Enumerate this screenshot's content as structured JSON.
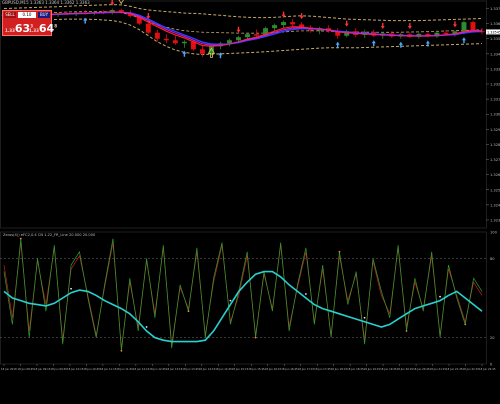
{
  "header": {
    "symbol_line": "GBPUSD,M15  1.3363 1.3364 1.3362 1.3363",
    "indicator_line": "Zeros(4)) eFC2,0.4 CN  1.22_FR_Line 20.000  20.000"
  },
  "trade_panel": {
    "sell_label": "SELL",
    "buy_label": "BUY",
    "lot_value": "0.10",
    "bid_prefix": "1.33",
    "bid_big": "63",
    "bid_sup": "3",
    "ask_prefix": "1.33",
    "ask_big": "64",
    "ask_sup": "8"
  },
  "colors": {
    "background": "#000000",
    "bull_candle": "#2e8b2e",
    "bear_candle": "#e01010",
    "ma_fast": "#ff2020",
    "ma_slow": "#3040ff",
    "ma_mid": "#cc22cc",
    "envelope": "#c9a86a",
    "osc_cyan": "#28d0d0",
    "osc_green": "#2e9e2e",
    "osc_red": "#c02020",
    "up_arrow": "#48a8ff",
    "down_arrow": "#ff3030",
    "grid": "#5a5a5a"
  },
  "chart_data": [
    {
      "type": "candlestick",
      "title": "",
      "y_ticks": [
        "1.33700",
        "1.33600",
        "1.33500",
        "1.33400",
        "1.33300",
        "1.33200",
        "1.33100",
        "1.33000",
        "1.32900",
        "1.32800",
        "1.32700",
        "1.32600",
        "1.32500",
        "1.32400",
        "1.32300"
      ],
      "ylim": [
        1.3226,
        1.3373
      ],
      "candles": [
        {
          "o": 1.33654,
          "h": 1.33672,
          "l": 1.33638,
          "c": 1.3366
        },
        {
          "o": 1.3366,
          "h": 1.3367,
          "l": 1.3364,
          "c": 1.33648
        },
        {
          "o": 1.33648,
          "h": 1.33668,
          "l": 1.3364,
          "c": 1.33662
        },
        {
          "o": 1.33662,
          "h": 1.33675,
          "l": 1.3365,
          "c": 1.33655
        },
        {
          "o": 1.33655,
          "h": 1.3367,
          "l": 1.33645,
          "c": 1.33664
        },
        {
          "o": 1.33664,
          "h": 1.33678,
          "l": 1.33652,
          "c": 1.33658
        },
        {
          "o": 1.33658,
          "h": 1.33672,
          "l": 1.33646,
          "c": 1.33668
        },
        {
          "o": 1.33668,
          "h": 1.3368,
          "l": 1.33655,
          "c": 1.33662
        },
        {
          "o": 1.33662,
          "h": 1.33676,
          "l": 1.3365,
          "c": 1.33672
        },
        {
          "o": 1.33672,
          "h": 1.3369,
          "l": 1.3366,
          "c": 1.33668
        },
        {
          "o": 1.33668,
          "h": 1.33682,
          "l": 1.33655,
          "c": 1.33676
        },
        {
          "o": 1.33676,
          "h": 1.3369,
          "l": 1.33662,
          "c": 1.3367
        },
        {
          "o": 1.3367,
          "h": 1.337,
          "l": 1.3366,
          "c": 1.3369
        },
        {
          "o": 1.3369,
          "h": 1.337,
          "l": 1.33668,
          "c": 1.33674
        },
        {
          "o": 1.33674,
          "h": 1.3369,
          "l": 1.3364,
          "c": 1.3365
        },
        {
          "o": 1.3365,
          "h": 1.3366,
          "l": 1.3359,
          "c": 1.336
        },
        {
          "o": 1.336,
          "h": 1.3361,
          "l": 1.3353,
          "c": 1.3354
        },
        {
          "o": 1.3354,
          "h": 1.3356,
          "l": 1.3348,
          "c": 1.335
        },
        {
          "o": 1.335,
          "h": 1.3353,
          "l": 1.3347,
          "c": 1.3349
        },
        {
          "o": 1.3349,
          "h": 1.3352,
          "l": 1.3346,
          "c": 1.3347
        },
        {
          "o": 1.3347,
          "h": 1.3349,
          "l": 1.3344,
          "c": 1.3348
        },
        {
          "o": 1.3348,
          "h": 1.3349,
          "l": 1.3342,
          "c": 1.3343
        },
        {
          "o": 1.3343,
          "h": 1.3345,
          "l": 1.3338,
          "c": 1.334
        },
        {
          "o": 1.334,
          "h": 1.3346,
          "l": 1.3339,
          "c": 1.3345
        },
        {
          "o": 1.3345,
          "h": 1.3348,
          "l": 1.3343,
          "c": 1.3347
        },
        {
          "o": 1.3347,
          "h": 1.335,
          "l": 1.3345,
          "c": 1.3349
        },
        {
          "o": 1.3349,
          "h": 1.3352,
          "l": 1.3347,
          "c": 1.3351
        },
        {
          "o": 1.3351,
          "h": 1.3354,
          "l": 1.3349,
          "c": 1.3353
        },
        {
          "o": 1.3353,
          "h": 1.3356,
          "l": 1.335,
          "c": 1.3352
        },
        {
          "o": 1.3352,
          "h": 1.3358,
          "l": 1.3351,
          "c": 1.3357
        },
        {
          "o": 1.3357,
          "h": 1.336,
          "l": 1.3355,
          "c": 1.3359
        },
        {
          "o": 1.3359,
          "h": 1.3362,
          "l": 1.3357,
          "c": 1.3361
        },
        {
          "o": 1.3361,
          "h": 1.3363,
          "l": 1.3358,
          "c": 1.33595
        },
        {
          "o": 1.33595,
          "h": 1.3361,
          "l": 1.3356,
          "c": 1.33575
        },
        {
          "o": 1.33575,
          "h": 1.3359,
          "l": 1.3354,
          "c": 1.33555
        },
        {
          "o": 1.33555,
          "h": 1.3358,
          "l": 1.3353,
          "c": 1.3357
        },
        {
          "o": 1.3357,
          "h": 1.3359,
          "l": 1.3354,
          "c": 1.3355
        },
        {
          "o": 1.3355,
          "h": 1.3357,
          "l": 1.335,
          "c": 1.3352
        },
        {
          "o": 1.3352,
          "h": 1.3356,
          "l": 1.3351,
          "c": 1.3355
        },
        {
          "o": 1.3355,
          "h": 1.3357,
          "l": 1.3351,
          "c": 1.33525
        },
        {
          "o": 1.33525,
          "h": 1.3356,
          "l": 1.33505,
          "c": 1.33545
        },
        {
          "o": 1.33545,
          "h": 1.3356,
          "l": 1.3351,
          "c": 1.3352
        },
        {
          "o": 1.3352,
          "h": 1.33545,
          "l": 1.335,
          "c": 1.33535
        },
        {
          "o": 1.33535,
          "h": 1.3355,
          "l": 1.33505,
          "c": 1.33515
        },
        {
          "o": 1.33515,
          "h": 1.3354,
          "l": 1.335,
          "c": 1.3353
        },
        {
          "o": 1.3353,
          "h": 1.33545,
          "l": 1.33505,
          "c": 1.33512
        },
        {
          "o": 1.33512,
          "h": 1.3354,
          "l": 1.335,
          "c": 1.33532
        },
        {
          "o": 1.33532,
          "h": 1.33545,
          "l": 1.33508,
          "c": 1.33515
        },
        {
          "o": 1.33515,
          "h": 1.3355,
          "l": 1.33505,
          "c": 1.3354
        },
        {
          "o": 1.3354,
          "h": 1.3356,
          "l": 1.3352,
          "c": 1.3353
        },
        {
          "o": 1.3353,
          "h": 1.33555,
          "l": 1.33515,
          "c": 1.33548
        },
        {
          "o": 1.33548,
          "h": 1.3362,
          "l": 1.3353,
          "c": 1.3361
        },
        {
          "o": 1.3361,
          "h": 1.3362,
          "l": 1.3354,
          "c": 1.3355
        },
        {
          "o": 1.3355,
          "h": 1.3357,
          "l": 1.3353,
          "c": 1.33545
        }
      ],
      "ma_red": [
        1.3365,
        1.33652,
        1.33655,
        1.33657,
        1.3366,
        1.33662,
        1.33664,
        1.33666,
        1.33668,
        1.3367,
        1.33672,
        1.33675,
        1.33678,
        1.33676,
        1.33665,
        1.3364,
        1.3361,
        1.3358,
        1.3355,
        1.33525,
        1.33505,
        1.3348,
        1.33455,
        1.3345,
        1.33455,
        1.33465,
        1.3348,
        1.33498,
        1.3351,
        1.3353,
        1.3355,
        1.3357,
        1.3358,
        1.33578,
        1.3357,
        1.33565,
        1.33558,
        1.33545,
        1.3354,
        1.33535,
        1.33532,
        1.33528,
        1.33526,
        1.33522,
        1.3352,
        1.33518,
        1.33518,
        1.33518,
        1.33522,
        1.33526,
        1.33532,
        1.33548,
        1.33556,
        1.33552
      ],
      "ma_blue": [
        1.33648,
        1.3365,
        1.33652,
        1.33655,
        1.33658,
        1.3366,
        1.33662,
        1.33664,
        1.33666,
        1.33668,
        1.3367,
        1.33672,
        1.33675,
        1.33676,
        1.33672,
        1.33655,
        1.3363,
        1.336,
        1.33572,
        1.33548,
        1.33525,
        1.33502,
        1.33478,
        1.33465,
        1.33462,
        1.33466,
        1.33475,
        1.33488,
        1.335,
        1.33515,
        1.33532,
        1.3355,
        1.33562,
        1.33568,
        1.33566,
        1.33563,
        1.33558,
        1.3355,
        1.33545,
        1.3354,
        1.33536,
        1.33532,
        1.33528,
        1.33525,
        1.33522,
        1.3352,
        1.33519,
        1.33519,
        1.33521,
        1.33524,
        1.33528,
        1.33538,
        1.33546,
        1.33548
      ],
      "envelope_upper": [
        1.337,
        1.33702,
        1.33704,
        1.33706,
        1.33708,
        1.3371,
        1.33712,
        1.33715,
        1.33718,
        1.3372,
        1.33722,
        1.33724,
        1.33726,
        1.33724,
        1.33715,
        1.337,
        1.3369,
        1.33685,
        1.3368,
        1.33675,
        1.3367,
        1.33668,
        1.33665,
        1.3366,
        1.33655,
        1.3365,
        1.33645,
        1.33642,
        1.3364,
        1.3364,
        1.33642,
        1.33645,
        1.3365,
        1.33652,
        1.3365,
        1.33645,
        1.3364,
        1.33635,
        1.3363,
        1.33628,
        1.33626,
        1.33624,
        1.33622,
        1.3362,
        1.3362,
        1.3362,
        1.3362,
        1.33622,
        1.33624,
        1.33626,
        1.33628,
        1.3363,
        1.33632,
        1.33634
      ],
      "envelope_lower": [
        1.3362,
        1.3362,
        1.33622,
        1.33624,
        1.33625,
        1.33626,
        1.33628,
        1.3363,
        1.3363,
        1.3363,
        1.33628,
        1.33625,
        1.3362,
        1.3361,
        1.3359,
        1.3356,
        1.3352,
        1.3348,
        1.3345,
        1.33425,
        1.3341,
        1.334,
        1.33395,
        1.33398,
        1.334,
        1.33402,
        1.33405,
        1.33408,
        1.3341,
        1.33414,
        1.33418,
        1.33422,
        1.33426,
        1.3343,
        1.33434,
        1.33438,
        1.3344,
        1.3344,
        1.3344,
        1.3344,
        1.33442,
        1.33444,
        1.33446,
        1.33448,
        1.3345,
        1.33452,
        1.33454,
        1.33456,
        1.33458,
        1.3346,
        1.33462,
        1.33464,
        1.33466,
        1.33468
      ],
      "up_arrows": [
        2,
        5,
        9,
        20,
        24,
        37,
        41,
        44,
        47,
        51
      ],
      "down_arrows": [
        12,
        16,
        26,
        31,
        33,
        38,
        42,
        45,
        50
      ],
      "hollow_up_arrows": [
        23
      ],
      "hollow_down_arrows": [
        13
      ]
    },
    {
      "type": "line",
      "title": "",
      "y_ticks": [
        "100",
        "80",
        "20",
        "0"
      ],
      "ylim": [
        0,
        100
      ],
      "levels": [
        80,
        20
      ],
      "series": [
        {
          "values": [
            55,
            50,
            48,
            46,
            45,
            44,
            46,
            50,
            54,
            56,
            55,
            52,
            48,
            45,
            42,
            38,
            32,
            25,
            20,
            18,
            17,
            17,
            17,
            17,
            18,
            25,
            35,
            45,
            55,
            62,
            68,
            70,
            70,
            66,
            60,
            55,
            50,
            45,
            42,
            40,
            38,
            36,
            34,
            32,
            30,
            28,
            30,
            34,
            38,
            42,
            44,
            46,
            48,
            52,
            55,
            50,
            45,
            40
          ]
        },
        {
          "values": [
            70,
            30,
            95,
            20,
            80,
            40,
            90,
            15,
            75,
            85,
            50,
            20,
            60,
            95,
            10,
            65,
            25,
            80,
            35,
            90,
            12,
            60,
            40,
            88,
            20,
            65,
            92,
            30,
            55,
            85,
            20,
            70,
            40,
            92,
            25,
            60,
            88,
            30,
            75,
            20,
            85,
            45,
            70,
            15,
            80,
            55,
            35,
            90,
            25,
            65,
            40,
            85,
            20,
            75,
            50,
            30,
            65,
            55
          ]
        },
        {
          "values": [
            75,
            35,
            92,
            25,
            78,
            45,
            88,
            18,
            72,
            82,
            52,
            22,
            58,
            92,
            12,
            62,
            28,
            78,
            38,
            88,
            15,
            58,
            42,
            85,
            22,
            62,
            90,
            32,
            52,
            82,
            22,
            68,
            42,
            90,
            28,
            58,
            85,
            32,
            72,
            22,
            82,
            48,
            68,
            18,
            78,
            52,
            38,
            88,
            28,
            62,
            42,
            82,
            22,
            72,
            52,
            32,
            62,
            52
          ]
        }
      ],
      "cyan_dots": [
        8,
        17,
        27,
        36,
        43,
        52
      ],
      "red_dots": [
        2,
        14,
        22,
        30,
        40,
        48,
        55
      ]
    }
  ],
  "x_axis_labels": [
    "18 Jun 2018",
    "18 Jun 08:45",
    "18 Jun 09:15",
    "18 Jun 09:45",
    "18 Jun 10:15",
    "18 Jun 10:45",
    "18 Jun 11:15",
    "18 Jun 11:45",
    "18 Jun 12:15",
    "18 Jun 12:45",
    "18 Jun 13:15",
    "18 Jun 13:45",
    "18 Jun 14:15",
    "18 Jun 14:45",
    "18 Jun 15:15",
    "18 Jun 15:45",
    "18 Jun 16:15",
    "18 Jun 16:45",
    "18 Jun 17:15",
    "18 Jun 17:45",
    "18 Jun 18:15",
    "18 Jun 18:45",
    "18 Jun 19:15",
    "18 Jun 19:45",
    "18 Jun 20:15",
    "18 Jun 20:45",
    "18 Jun 21:15",
    "18 Jun 21:45",
    "18 Jun 22:15",
    "18 Jun 22:45"
  ]
}
